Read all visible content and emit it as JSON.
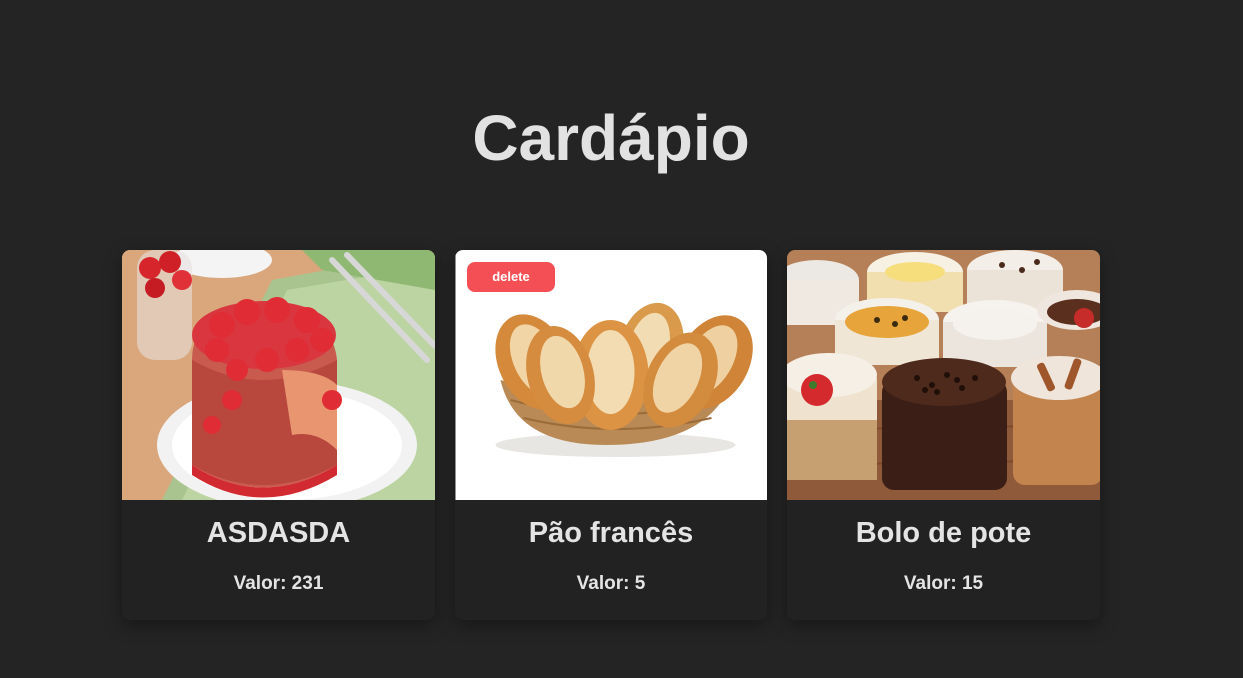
{
  "page": {
    "title": "Cardápio"
  },
  "menu": {
    "items": [
      {
        "name": "ASDASDA",
        "price_text": "Valor: 231",
        "image": "strawberry-bundt-cake-photo"
      },
      {
        "name": "Pão francês",
        "price_text": "Valor: 5",
        "image": "bread-basket-photo",
        "delete_label": "delete"
      },
      {
        "name": "Bolo de pote",
        "price_text": "Valor: 15",
        "image": "cake-jars-photo"
      }
    ]
  },
  "colors": {
    "background": "#242424",
    "card": "#222222",
    "text": "#e4e4e4",
    "delete_button": "#f44f55"
  }
}
